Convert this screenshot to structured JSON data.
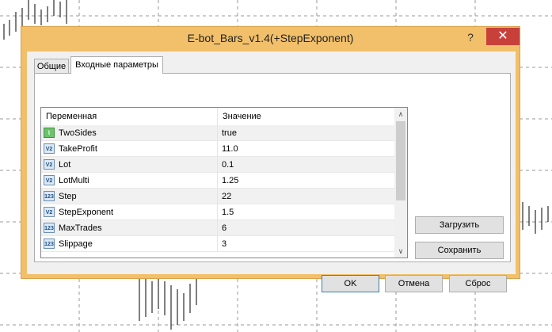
{
  "window": {
    "title": "E-bot_Bars_v1.4(+StepExponent)",
    "help_glyph": "?",
    "close_glyph": "✕"
  },
  "tabs": [
    {
      "label": "Общие"
    },
    {
      "label": "Входные параметры"
    }
  ],
  "table": {
    "headers": {
      "variable": "Переменная",
      "value": "Значение"
    },
    "rows": [
      {
        "icon": "bool-icon",
        "icon_text": "",
        "name": "TwoSides",
        "value": "true"
      },
      {
        "icon": "double-icon",
        "icon_text": "V2",
        "name": "TakeProfit",
        "value": "11.0"
      },
      {
        "icon": "double-icon",
        "icon_text": "V2",
        "name": "Lot",
        "value": "0.1"
      },
      {
        "icon": "double-icon",
        "icon_text": "V2",
        "name": "LotMulti",
        "value": "1.25"
      },
      {
        "icon": "int-icon",
        "icon_text": "123",
        "name": "Step",
        "value": "22"
      },
      {
        "icon": "double-icon",
        "icon_text": "V2",
        "name": "StepExponent",
        "value": "1.5"
      },
      {
        "icon": "int-icon",
        "icon_text": "123",
        "name": "MaxTrades",
        "value": "6"
      },
      {
        "icon": "int-icon",
        "icon_text": "123",
        "name": "Slippage",
        "value": "3"
      }
    ],
    "scroll_up": "∧",
    "scroll_down": "∨"
  },
  "side_buttons": {
    "load": "Загрузить",
    "save": "Сохранить"
  },
  "footer_buttons": {
    "ok": "OK",
    "cancel": "Отмена",
    "reset": "Сброс"
  }
}
